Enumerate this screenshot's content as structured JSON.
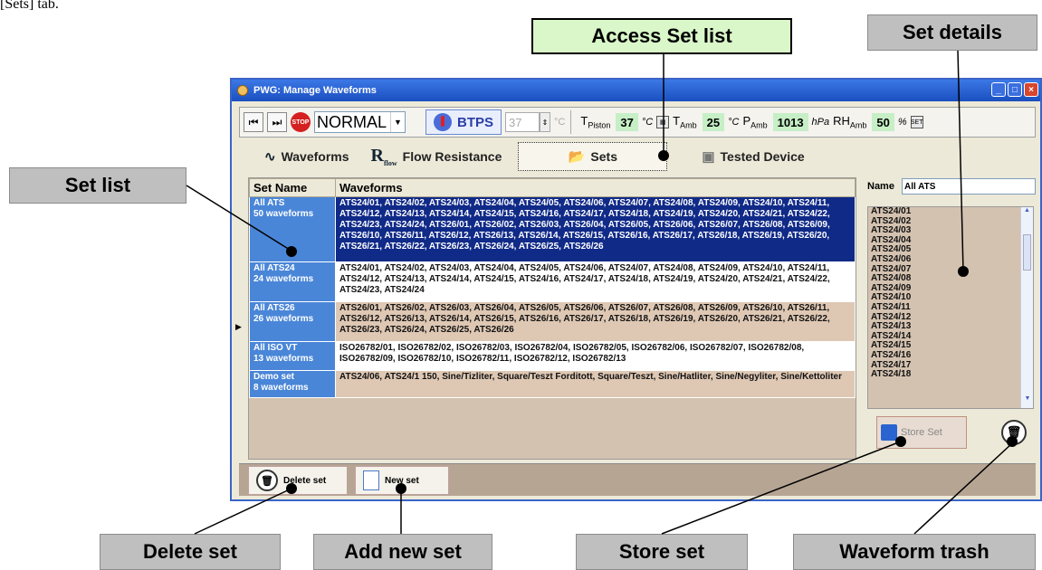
{
  "intro_text": "[Sets] tab.",
  "callouts": {
    "access_set_list": "Access Set list",
    "set_details": "Set details",
    "set_list": "Set list",
    "delete_set": "Delete set",
    "add_new_set": "Add new set",
    "store_set": "Store set",
    "waveform_trash": "Waveform trash"
  },
  "window": {
    "title": "PWG: Manage Waveforms"
  },
  "toolbar": {
    "mode": "NORMAL",
    "btps": "BTPS",
    "btps_value": "37",
    "btps_unit": "°C",
    "t_piston_label": "T",
    "t_piston_sub": "Piston",
    "t_piston_value": "37",
    "t_piston_unit": "°C",
    "t_amb_label": "T",
    "t_amb_sub": "Amb",
    "t_amb_value": "25",
    "t_amb_unit": "°C",
    "p_amb_label": "P",
    "p_amb_sub": "Amb",
    "p_amb_value": "1013",
    "p_amb_unit": "hPa",
    "rh_amb_label": "RH",
    "rh_amb_sub": "Amb",
    "rh_amb_value": "50",
    "rh_amb_unit": "%"
  },
  "tabs": {
    "waveforms": "Waveforms",
    "flow_resistance_icon": "R",
    "flow_resistance_icon_sub": "flow",
    "flow_resistance": "Flow Resistance",
    "sets": "Sets",
    "tested_device": "Tested Device"
  },
  "table": {
    "col_set_name": "Set Name",
    "col_waveforms": "Waveforms",
    "rows": [
      {
        "name": "All ATS",
        "count": "50 waveforms",
        "waveforms": "ATS24/01, ATS24/02, ATS24/03, ATS24/04, ATS24/05, ATS24/06, ATS24/07, ATS24/08, ATS24/09, ATS24/10, ATS24/11, ATS24/12, ATS24/13, ATS24/14, ATS24/15, ATS24/16, ATS24/17, ATS24/18, ATS24/19, ATS24/20, ATS24/21, ATS24/22, ATS24/23, ATS24/24, ATS26/01, ATS26/02, ATS26/03, ATS26/04, ATS26/05, ATS26/06, ATS26/07, ATS26/08, ATS26/09, ATS26/10, ATS26/11, ATS26/12, ATS26/13, ATS26/14, ATS26/15, ATS26/16, ATS26/17, ATS26/18, ATS26/19, ATS26/20, ATS26/21, ATS26/22, ATS26/23, ATS26/24, ATS26/25, ATS26/26"
      },
      {
        "name": "All ATS24",
        "count": "24 waveforms",
        "waveforms": "ATS24/01, ATS24/02, ATS24/03, ATS24/04, ATS24/05, ATS24/06, ATS24/07, ATS24/08, ATS24/09, ATS24/10, ATS24/11, ATS24/12, ATS24/13, ATS24/14, ATS24/15, ATS24/16, ATS24/17, ATS24/18, ATS24/19, ATS24/20, ATS24/21, ATS24/22, ATS24/23, ATS24/24"
      },
      {
        "name": "All ATS26",
        "count": "26 waveforms",
        "waveforms": "ATS26/01, ATS26/02, ATS26/03, ATS26/04, ATS26/05, ATS26/06, ATS26/07, ATS26/08, ATS26/09, ATS26/10, ATS26/11, ATS26/12, ATS26/13, ATS26/14, ATS26/15, ATS26/16, ATS26/17, ATS26/18, ATS26/19, ATS26/20, ATS26/21, ATS26/22, ATS26/23, ATS26/24, ATS26/25, ATS26/26"
      },
      {
        "name": "All ISO VT",
        "count": "13 waveforms",
        "waveforms": "ISO26782/01, ISO26782/02, ISO26782/03, ISO26782/04, ISO26782/05, ISO26782/06, ISO26782/07, ISO26782/08, ISO26782/09, ISO26782/10, ISO26782/11, ISO26782/12, ISO26782/13"
      },
      {
        "name": "Demo set",
        "count": "8 waveforms",
        "waveforms": "ATS24/06, ATS24/1 150, Sine/Tizliter, Square/Teszt Forditott, Square/Teszt, Sine/Hatliter, Sine/Negyliter, Sine/Kettoliter"
      }
    ]
  },
  "details": {
    "name_label": "Name",
    "name_value": "All ATS",
    "list": [
      "ATS24/01",
      "ATS24/02",
      "ATS24/03",
      "ATS24/04",
      "ATS24/05",
      "ATS24/06",
      "ATS24/07",
      "ATS24/08",
      "ATS24/09",
      "ATS24/10",
      "ATS24/11",
      "ATS24/12",
      "ATS24/13",
      "ATS24/14",
      "ATS24/15",
      "ATS24/16",
      "ATS24/17",
      "ATS24/18"
    ],
    "store_set": "Store Set"
  },
  "bottom": {
    "delete_set": "Delete set",
    "new_set": "New set"
  },
  "colors": {
    "selected_row": "#102a88",
    "set_name_cell": "#4a86d8",
    "table_bg": "#d4c2b0",
    "value_green": "#c6efc6"
  }
}
